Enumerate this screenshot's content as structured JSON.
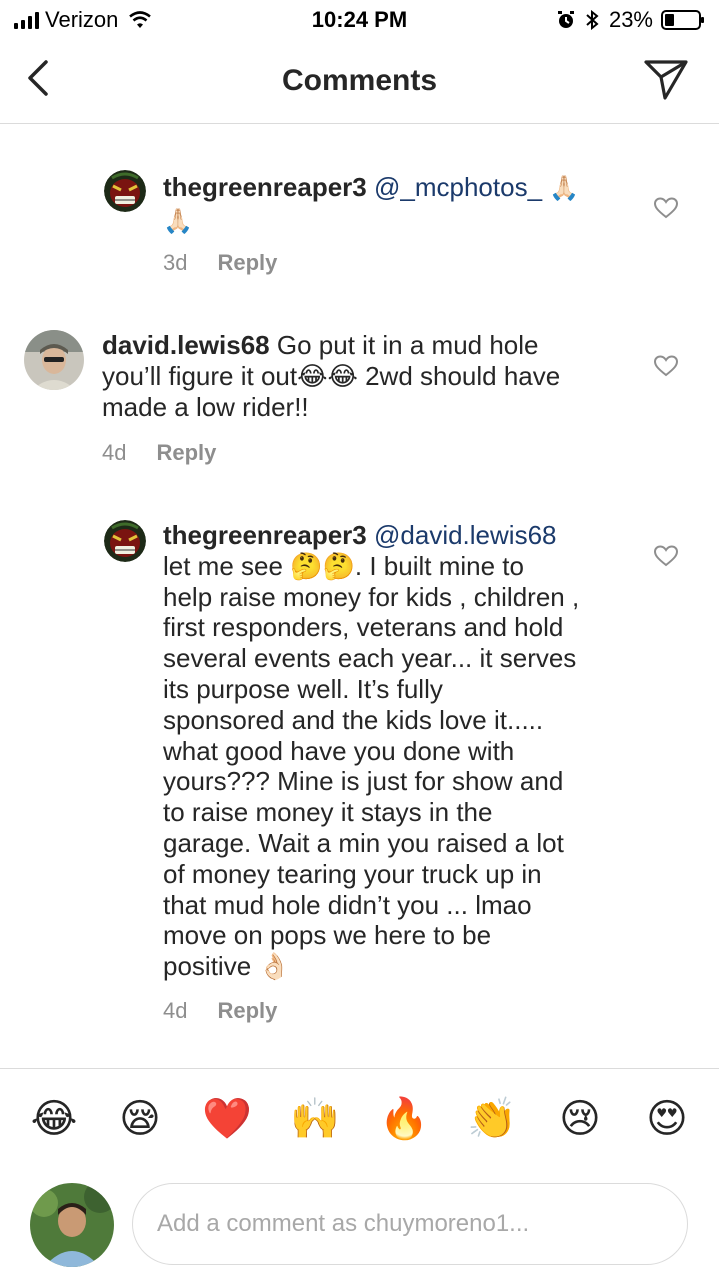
{
  "status_bar": {
    "carrier": "Verizon",
    "time": "10:24 PM",
    "battery": "23%",
    "icons": [
      "signal-icon",
      "wifi-icon",
      "alarm-icon",
      "bluetooth-icon",
      "battery-icon"
    ]
  },
  "header": {
    "title": "Comments",
    "back_icon": "chevron-left-icon",
    "share_icon": "send-icon"
  },
  "comments": [
    {
      "username": "thegreenreaper3",
      "mention": "@_mcphotos_",
      "text_line2": "🙏🏻",
      "text_line1_emoji": "🙏🏻",
      "time": "3d",
      "reply_label": "Reply"
    },
    {
      "username": "david.lewis68",
      "text": [
        "Go put it in a mud hole",
        "you’ll figure it out😂😂 2wd should have",
        "made a low rider!!"
      ],
      "time": "4d",
      "reply_label": "Reply"
    },
    {
      "username": "thegreenreaper3",
      "mention": "@david.lewis68",
      "text": [
        "let me see 🤔🤔. I built mine to",
        "help raise money for kids , children ,",
        "first responders, veterans and hold",
        "several events each year... it serves",
        "its purpose well.  It’s fully",
        "sponsored and the kids love it.....",
        "what good have you done with",
        "yours??? Mine is just for show and",
        "to raise money it stays in the",
        "garage.  Wait a min you raised a lot",
        "of money tearing your truck up in",
        "that mud hole didn’t you ... lmao",
        "move on pops we here to be",
        "positive 👌🏻"
      ],
      "time": "4d",
      "reply_label": "Reply"
    }
  ],
  "quick_reactions": [
    "😂",
    "😪",
    "❤️",
    "🙌",
    "🔥",
    "👏",
    "😢",
    "😍"
  ],
  "composer": {
    "placeholder": "Add a comment as chuymoreno1..."
  },
  "colors": {
    "text": "#262626",
    "muted": "#8e8e8e",
    "mention": "#1b3a6b",
    "divider": "#dbdbdb"
  }
}
